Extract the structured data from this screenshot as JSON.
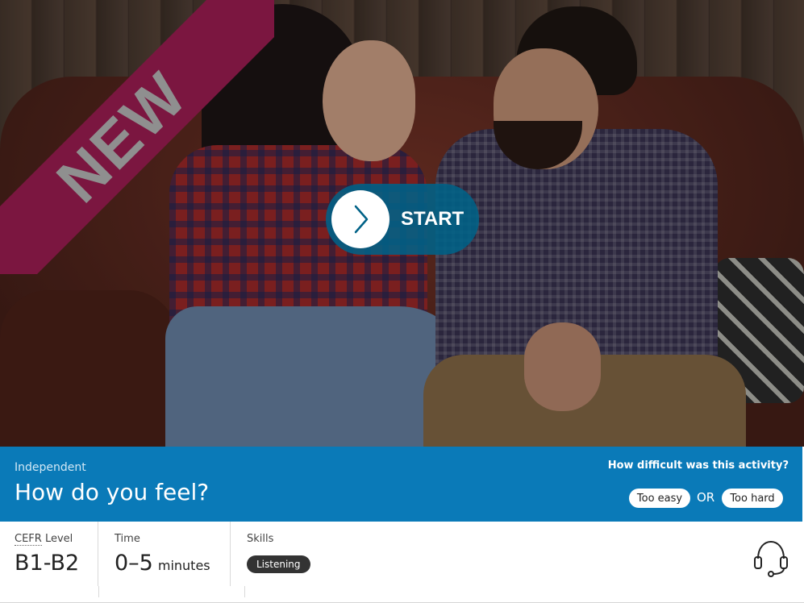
{
  "hero": {
    "ribbon_label": "NEW",
    "start_label": "START"
  },
  "activity": {
    "level_tag": "Independent",
    "title": "How do you feel?",
    "difficulty_question": "How difficult was this activity?",
    "too_easy_label": "Too easy",
    "or_label": "OR",
    "too_hard_label": "Too hard"
  },
  "meta": {
    "cefr_abbr": "CEFR",
    "cefr_label_suffix": " Level",
    "cefr_value": "B1-B2",
    "time_label": "Time",
    "time_value": "0–5",
    "time_unit": "minutes",
    "skills_label": "Skills",
    "skills": [
      "Listening"
    ]
  },
  "icons": {
    "start": "chevron-right-icon",
    "audio": "headset-icon"
  },
  "colors": {
    "ribbon": "#7b1640",
    "band": "#0a7ab8",
    "start_button": "#006287",
    "badge": "#333333"
  }
}
